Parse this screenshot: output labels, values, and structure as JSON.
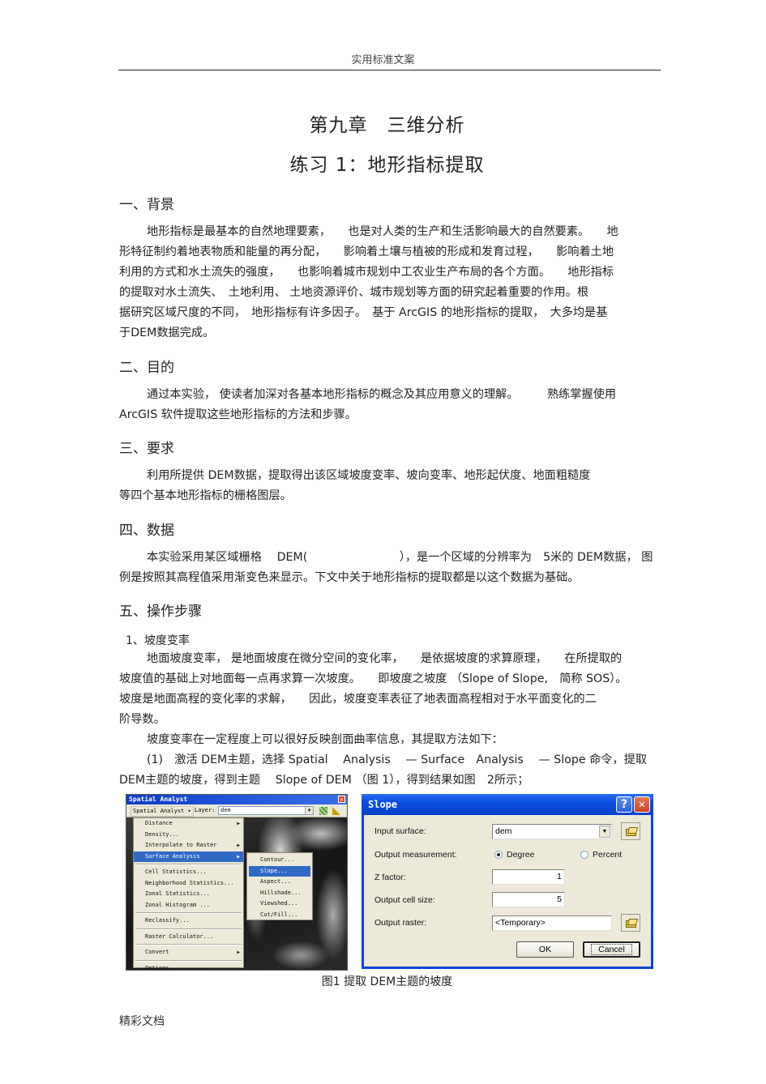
{
  "header": {
    "text": "实用标准文案"
  },
  "titles": {
    "chapter": "第九章　三维分析",
    "exercise": "练习 1：地形指标提取"
  },
  "sections": [
    {
      "heading": "一、背景",
      "lines": [
        "地形指标是最基本的自然地理要素，　　也是对人类的生产和生活影响最大的自然要素。　　地",
        "形特征制约着地表物质和能量的再分配，　　影响着土壤与植被的形成和发育过程，　　影响着土地",
        "利用的方式和水土流失的强度，　　也影响着城市规划中工农业生产布局的各个方面。　　地形指标",
        "的提取对水土流失、　土地利用、 土地资源评价、城市规划等方面的研究起着重要的作用。根",
        "据研究区域尺度的不同，　地形指标有许多因子。　基于 ArcGIS 的地形指标的提取，　大多均是基",
        "于DEM数据完成。"
      ]
    },
    {
      "heading": "二、目的",
      "lines": [
        "通过本实验，  使读者加深对各基本地形指标的概念及其应用意义的理解。　　　熟练掌握使用",
        "ArcGIS 软件提取这些地形指标的方法和步骤。"
      ]
    },
    {
      "heading": "三、要求",
      "lines": [
        "利用所提供  DEM数据，提取得出该区域坡度变率、坡向变率、地形起伏度、地面粗糙度",
        "等四个基本地形指标的栅格图层。"
      ]
    },
    {
      "heading": "四、数据",
      "lines": [
        "本实验采用某区域栅格　 DEM(　　　　　　　　），是一个区域的分辨率为　5米的 DEM数据，  图",
        "例是按照其高程值采用渐变色来显示。下文中关于地形指标的提取都是以这个数据为基础。"
      ]
    },
    {
      "heading": "五、操作步骤",
      "subheading": "1、坡度变率",
      "lines": [
        "地面坡度变率，  是地面坡度在微分空间的变化率，　　是依据坡度的求算原理，　　在所提取的",
        "坡度值的基础上对地面每一点再求算一次坡度。　　即坡度之坡度 （Slope  of  Slope,　简称 SOS）。",
        "坡度是地面高程的变化率的求解，　　因此，坡度变率表征了地表面高程相对于水平面变化的二",
        "阶导数。",
        "坡度变率在一定程度上可以很好反映剖面曲率信息，其提取方法如下：",
        "(1)　激活 DEM主题，选择  Spatial　 Analysis　 — Surface　Analysis　 — Slope 命令，提取",
        "DEM主题的坡度，得到主题　 Slope of DEM （图 1），得到结果如图　2所示；"
      ]
    }
  ],
  "spatial_analyst": {
    "title": "Spatial Analyst",
    "toolbar_menu": "Spatial Analyst ▾",
    "layer_label": "Layer:",
    "layer_value": "dem",
    "menu_items": [
      {
        "label": "Distance",
        "submenu": true
      },
      {
        "label": "Density...",
        "submenu": false
      },
      {
        "label": "Interpolate to Raster",
        "submenu": true
      },
      {
        "label": "Surface Analysis",
        "submenu": true,
        "highlighted": true
      },
      {
        "label": "Cell Statistics...",
        "submenu": false
      },
      {
        "label": "Neighborhood Statistics...",
        "submenu": false
      },
      {
        "label": "Zonal Statistics...",
        "submenu": false
      },
      {
        "label": "Zonal Histogram ...",
        "submenu": false
      },
      {
        "label": "Reclassify...",
        "submenu": false
      },
      {
        "label": "Raster Calculator...",
        "submenu": false
      },
      {
        "label": "Convert",
        "submenu": true
      },
      {
        "label": "Options...",
        "submenu": false
      }
    ],
    "submenu_items": [
      {
        "label": "Contour..."
      },
      {
        "label": "Slope...",
        "highlighted": true
      },
      {
        "label": "Aspect..."
      },
      {
        "label": "Hillshade..."
      },
      {
        "label": "Viewshed..."
      },
      {
        "label": "Cut/Fill..."
      }
    ]
  },
  "slope_dialog": {
    "title": "Slope",
    "help_label": "?",
    "close_label": "✕",
    "input_surface_label": "Input surface:",
    "input_surface_value": "dem",
    "output_measurement_label": "Output measurement:",
    "measurement_options": [
      "Degree",
      "Percent"
    ],
    "measurement_selected": "Degree",
    "z_factor_label": "Z factor:",
    "z_factor_value": "1",
    "cell_size_label": "Output cell size:",
    "cell_size_value": "5",
    "output_raster_label": "Output raster:",
    "output_raster_value": "<Temporary>",
    "ok_label": "OK",
    "cancel_label": "Cancel"
  },
  "caption": "图1  提取 DEM主题的坡度",
  "footer": {
    "text": "精彩文档"
  }
}
